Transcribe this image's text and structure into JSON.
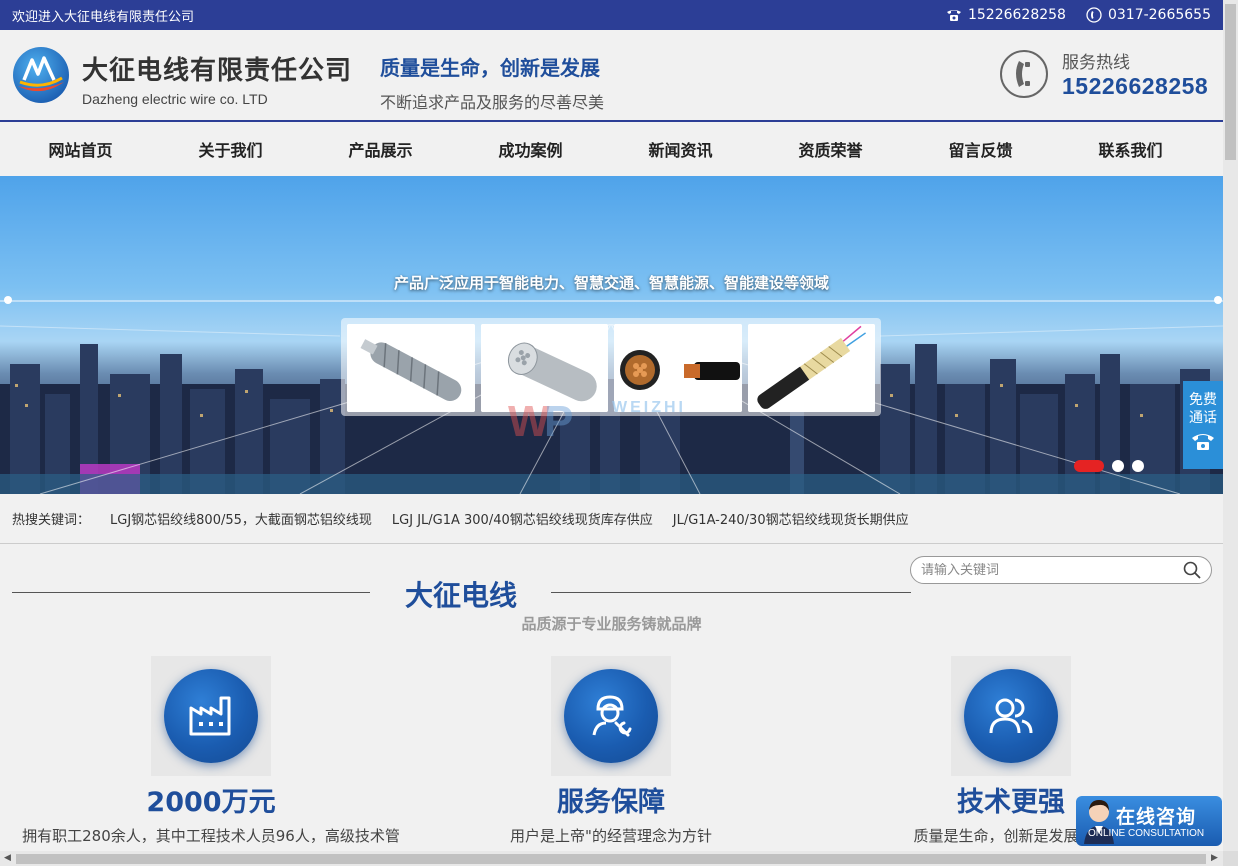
{
  "topbar": {
    "welcome": "欢迎进入大征电线有限责任公司",
    "phone": "15226628258",
    "tel": "0317-2665655"
  },
  "header": {
    "company_cn": "大征电线有限责任公司",
    "company_en": "Dazheng electric wire co. LTD",
    "slogan_main": "质量是生命，创新是发展",
    "slogan_sub": "不断追求产品及服务的尽善尽美",
    "hotline_label": "服务热线",
    "hotline_number": "15226628258"
  },
  "nav": {
    "items": [
      "网站首页",
      "关于我们",
      "产品展示",
      "成功案例",
      "新闻资讯",
      "资质荣誉",
      "留言反馈",
      "联系我们"
    ]
  },
  "banner": {
    "tagline": "产品广泛应用于智能电力、智慧交通、智慧能源、智能建设等领域",
    "watermark": "WEIZHI",
    "slides": 3,
    "active_slide": 1
  },
  "keywords": {
    "label": "热搜关键词：",
    "items": [
      "LGJ钢芯铝绞线800/55，大截面钢芯铝绞线现",
      "LGJ JL/G1A 300/40钢芯铝绞线现货库存供应",
      "JL/G1A-240/30钢芯铝绞线现货长期供应"
    ]
  },
  "search": {
    "placeholder": "请输入关键词",
    "value": ""
  },
  "section": {
    "title": "大征电线",
    "subtitle": "品质源于专业服务铸就品牌"
  },
  "features": [
    {
      "icon": "factory-icon",
      "title": "2000万元",
      "desc": "拥有职工280余人，其中工程技术人员96人，高级技术管"
    },
    {
      "icon": "engineer-icon",
      "title": "服务保障",
      "desc": "用户是上帝\"的经营理念为方针"
    },
    {
      "icon": "users-icon",
      "title": "技术更强",
      "desc": "质量是生命，创新是发展，诚"
    }
  ],
  "side_float": {
    "label": "免费通话"
  },
  "consult": {
    "label": "在线咨询",
    "label_en": "ONLINE CONSULTATION"
  },
  "colors": {
    "brand_blue": "#2c3e96",
    "title_blue": "#1f4e9b",
    "active_dot": "#e52323",
    "side_float": "#2b8fd8"
  }
}
